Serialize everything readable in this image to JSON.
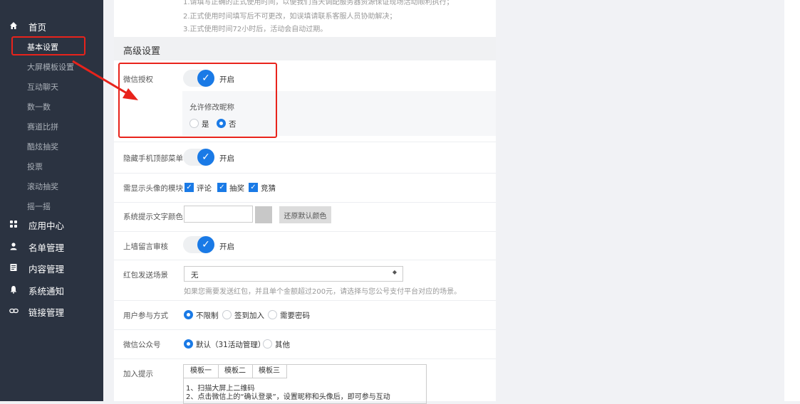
{
  "sidebar": {
    "home": "首页",
    "sub_items": [
      "基本设置",
      "大屏模板设置",
      "互动聊天",
      "数一数",
      "赛道比拼",
      "酷炫抽奖",
      "投票",
      "滚动抽奖",
      "摇一摇"
    ],
    "sections": [
      "应用中心",
      "名单管理",
      "内容管理",
      "系统通知",
      "链接管理"
    ]
  },
  "notes": [
    "1.请填写正确的正式使用时间，以便我们当天调配服务器资源保证现场活动顺利执行；",
    "2.正式使用时间填写后不可更改，如误填请联系客服人员协助解决；",
    "3.正式使用时间72小时后，活动会自动过期。"
  ],
  "section_title": "高级设置",
  "wechat_auth": {
    "label": "微信授权",
    "state": "开启",
    "sub_label": "允许修改昵称",
    "yes": "是",
    "no": "否"
  },
  "hide_menu": {
    "label": "隐藏手机顶部菜单",
    "state": "开启"
  },
  "avatar_modules": {
    "label": "需显示头像的模块",
    "options": [
      "评论",
      "抽奖",
      "竞猜"
    ]
  },
  "tip_color": {
    "label": "系统提示文字颜色",
    "value": "",
    "reset": "还原默认颜色"
  },
  "wall_review": {
    "label": "上墙留言审核",
    "state": "开启"
  },
  "red_packet": {
    "label": "红包发送场景",
    "value": "无",
    "help": "如果您需要发送红包，并且单个金额超过200元，请选择与您公号支付平台对应的场景。"
  },
  "participation": {
    "label": "用户参与方式",
    "options": [
      "不限制",
      "签到加入",
      "需要密码"
    ]
  },
  "wechat_account": {
    "label": "微信公众号",
    "options": [
      "默认（31活动管理）",
      "其他"
    ]
  },
  "join_tip": {
    "label": "加入提示",
    "tabs": [
      "模板一",
      "模板二",
      "模板三"
    ],
    "lines": [
      "1、扫描大屏上二维码",
      "2、点击微信上的“确认登录”，设置昵称和头像后，即可参与互动"
    ]
  },
  "colors": {
    "accent": "#1a7ae6",
    "highlight": "#e8231b",
    "sidebar": "#2b3341"
  }
}
